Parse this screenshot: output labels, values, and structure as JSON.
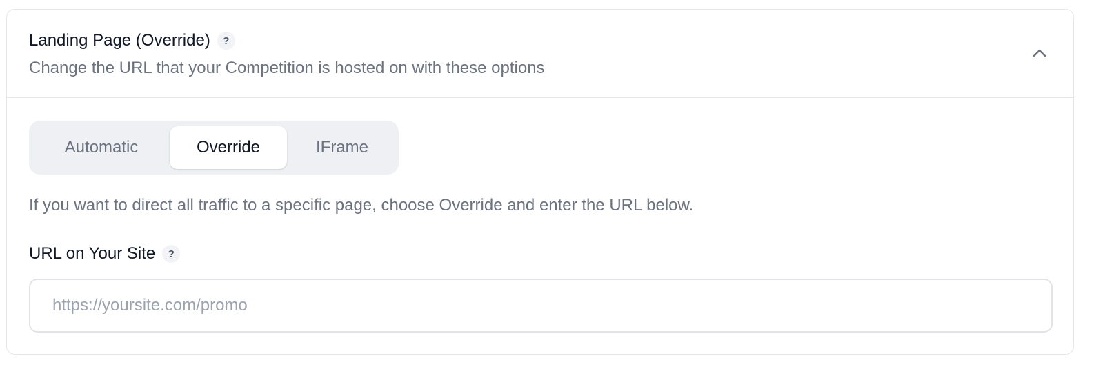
{
  "section": {
    "title": "Landing Page (Override)",
    "help_icon": "question-mark-icon",
    "subtitle": "Change the URL that your Competition is hosted on with these options",
    "toggle_icon": "chevron-up-icon",
    "expanded": true
  },
  "mode_selector": {
    "options": [
      {
        "label": "Automatic"
      },
      {
        "label": "Override"
      },
      {
        "label": "IFrame"
      }
    ],
    "selected": "Override"
  },
  "hint": "If you want to direct all traffic to a specific page, choose Override and enter the URL below.",
  "url_field": {
    "label": "URL on Your Site",
    "help_icon": "question-mark-icon",
    "value": "",
    "placeholder": "https://yoursite.com/promo"
  },
  "colors": {
    "text_primary": "#111827",
    "text_secondary": "#6b7280",
    "border": "#e5e7eb",
    "segmented_bg": "#eef0f3"
  }
}
